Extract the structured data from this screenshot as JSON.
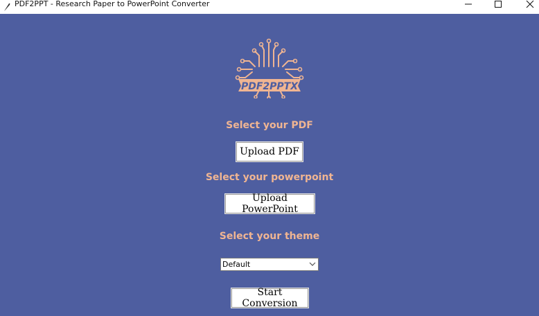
{
  "window": {
    "title": "PDF2PPT - Research Paper to PowerPoint Converter",
    "app_icon": "feather-icon",
    "controls": [
      "minimize-icon",
      "maximize-icon",
      "close-icon"
    ]
  },
  "logo": {
    "text": "PDF2PPTX",
    "icon": "circuit-board-icon",
    "color": "#f0b592"
  },
  "pdf_section": {
    "label": "Select your PDF",
    "button_label": "Upload PDF"
  },
  "ppt_section": {
    "label": "Select your powerpoint",
    "button_label": "Upload PowerPoint"
  },
  "theme_section": {
    "label": "Select your theme",
    "selected": "Default"
  },
  "start_button_label": "Start Conversion",
  "colors": {
    "background": "#4e5ea0",
    "accent": "#f0b592",
    "button_bg": "#ffffff"
  }
}
